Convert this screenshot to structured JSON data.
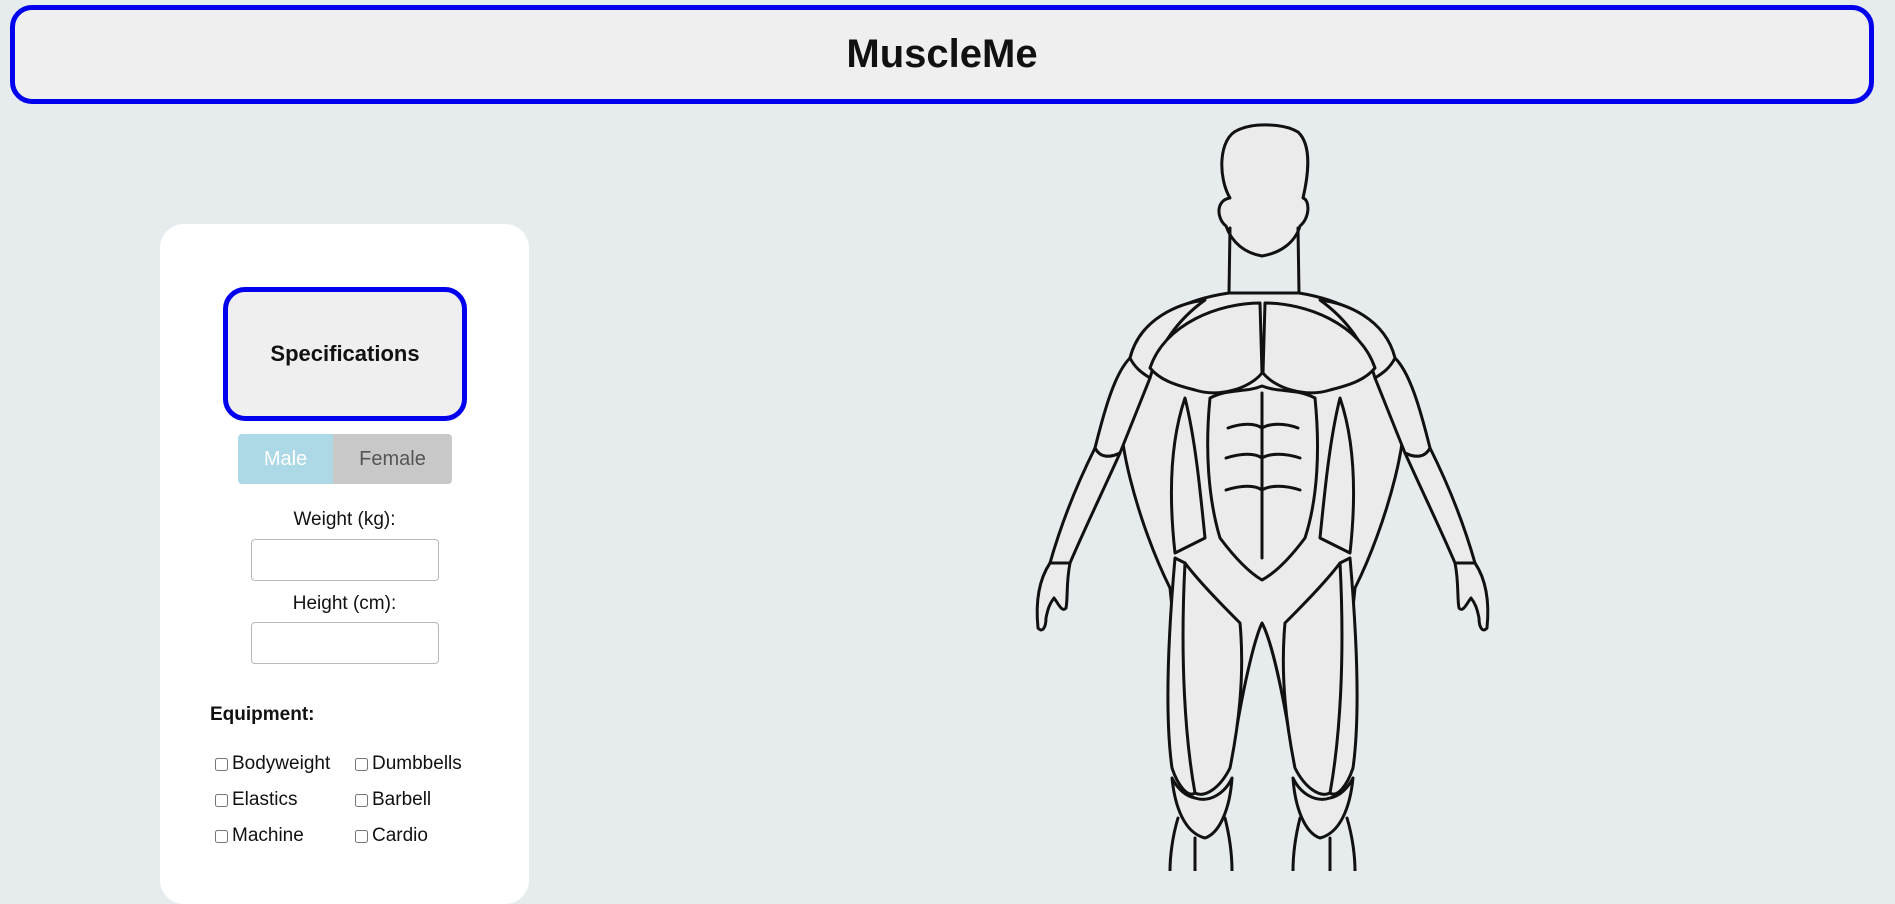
{
  "header": {
    "title": "MuscleMe"
  },
  "specs": {
    "title": "Specifications",
    "gender": {
      "male": "Male",
      "female": "Female",
      "selected": "Male"
    },
    "weight_label": "Weight (kg):",
    "weight_value": "",
    "height_label": "Height (cm):",
    "height_value": "",
    "equipment": {
      "title": "Equipment:",
      "items": [
        "Bodyweight",
        "Dumbbells",
        "Elastics",
        "Barbell",
        "Machine",
        "Cardio"
      ]
    }
  },
  "colors": {
    "accent_border": "#0000ee",
    "male_selected": "#add8e6",
    "female_unselected": "#c8c8c8",
    "background": "#e6ebee"
  },
  "icons": {
    "body": "human-muscle-anatomy-figure"
  }
}
